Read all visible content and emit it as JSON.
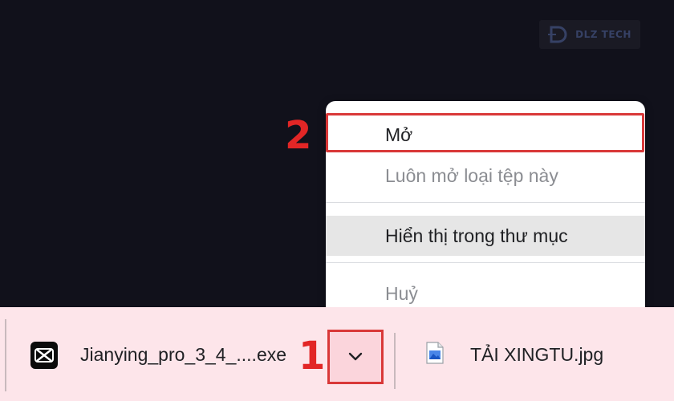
{
  "watermark": {
    "text": "DLZ TECH",
    "logo_letter": "D"
  },
  "context_menu": {
    "items": [
      {
        "label": "Mở",
        "enabled": true
      },
      {
        "label": "Luôn mở loại tệp này",
        "enabled": false
      },
      {
        "label": "Hiển thị trong thư mục",
        "enabled": true,
        "hovered": true
      },
      {
        "label": "Huỷ",
        "enabled": false
      }
    ]
  },
  "annotations": {
    "step_1": "1",
    "step_2": "2",
    "highlight_color": "#d93838"
  },
  "downloads": {
    "items": [
      {
        "name": "Jianying_pro_3_4_....exe",
        "icon": "capcut-icon"
      },
      {
        "name": "TẢI XINGTU.jpg",
        "icon": "image-file-icon"
      }
    ],
    "menu_button_icon": "chevron-down-icon"
  },
  "colors": {
    "background": "#11111b",
    "download_bar": "#fde5ea",
    "menu_bg": "#ffffff",
    "hover_bg": "#e6e6e6",
    "annotation_red": "#e22626"
  }
}
